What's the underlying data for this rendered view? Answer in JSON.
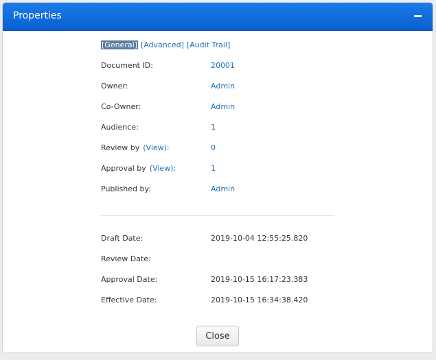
{
  "header": {
    "title": "Properties"
  },
  "tabs": [
    {
      "label": "[General]"
    },
    {
      "label": "[Advanced]"
    },
    {
      "label": "[Audit Trail]"
    }
  ],
  "properties": {
    "document_id": {
      "label": "Document ID:",
      "value": "20001"
    },
    "owner": {
      "label": "Owner:",
      "value": "Admin"
    },
    "co_owner": {
      "label": "Co-Owner:",
      "value": "Admin"
    },
    "audience": {
      "label": "Audience:",
      "value": "1"
    },
    "review_by": {
      "label": "Review by",
      "view_label": "(View):",
      "value": "0"
    },
    "approval_by": {
      "label": "Approval by",
      "view_label": "(View):",
      "value": "1"
    },
    "published_by": {
      "label": "Published by:",
      "value": "Admin"
    }
  },
  "dates": {
    "draft": {
      "label": "Draft Date:",
      "value": "2019-10-04 12:55:25.820"
    },
    "review": {
      "label": "Review Date:",
      "value": ""
    },
    "approval": {
      "label": "Approval Date:",
      "value": "2019-10-15 16:17:23.383"
    },
    "effective": {
      "label": "Effective Date:",
      "value": "2019-10-15 16:34:38.420"
    }
  },
  "footer": {
    "close_label": "Close"
  },
  "colors": {
    "header": "#0a6ad8",
    "link": "#1a6fb8",
    "active_tab": "#5b7ea2"
  },
  "icons": {
    "collapse": "minus-icon"
  }
}
